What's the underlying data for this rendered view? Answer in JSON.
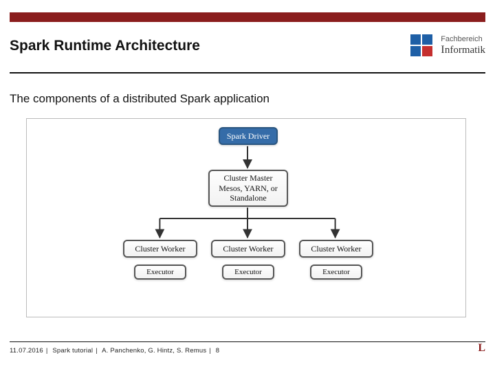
{
  "header": {
    "title": "Spark Runtime Architecture",
    "logo_top": "Fachbereich",
    "logo_bottom": "Informatik"
  },
  "subhead": "The components of a distributed Spark application",
  "diagram": {
    "driver": "Spark Driver",
    "master_line1": "Cluster Master",
    "master_line2": "Mesos, YARN, or",
    "master_line3": "Standalone",
    "worker": "Cluster Worker",
    "executor": "Executor"
  },
  "footer": {
    "date": "11.07.2016",
    "course": "Spark tutorial",
    "authors": "A. Panchenko, G. Hintz, S. Remus",
    "page": "8",
    "logo": "L"
  }
}
